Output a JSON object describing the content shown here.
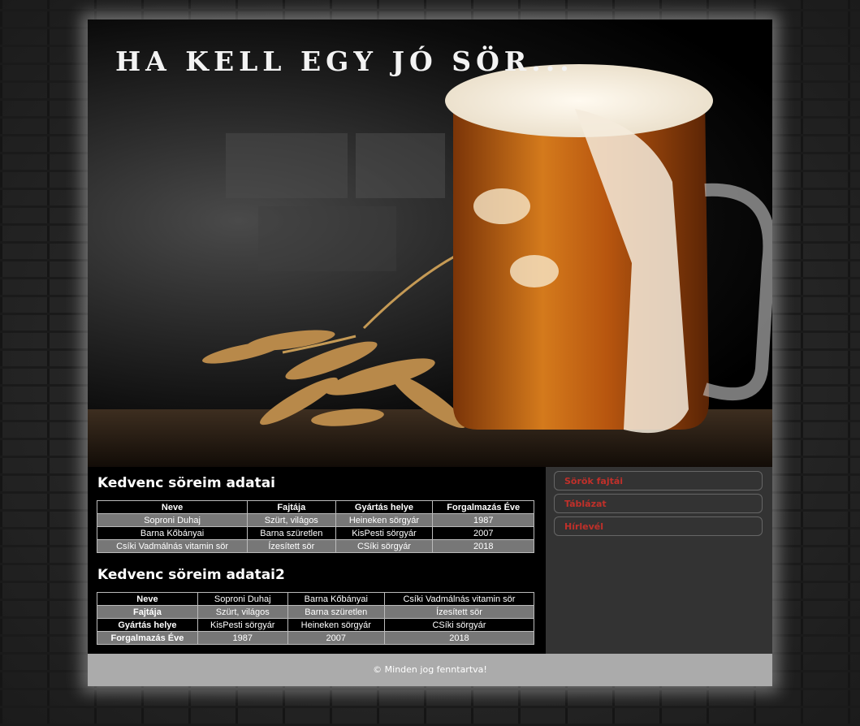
{
  "header": {
    "title": "HA KELL EGY JÓ SÖR..."
  },
  "section1": {
    "title": "Kedvenc söreim adatai",
    "columns": [
      "Neve",
      "Fajtája",
      "Gyártás helye",
      "Forgalmazás Éve"
    ],
    "rows": [
      [
        "Soproni Duhaj",
        "Szürt, világos",
        "Heineken sörgyár",
        "1987"
      ],
      [
        "Barna Kőbányai",
        "Barna szüretlen",
        "KisPesti sörgyár",
        "2007"
      ],
      [
        "Csíki Vadmálnás vitamin sör",
        "Ízesített sör",
        "CSíki sörgyár",
        "2018"
      ]
    ]
  },
  "section2": {
    "title": "Kedvenc söreim adatai2",
    "rows": [
      [
        "Neve",
        "Soproni Duhaj",
        "Barna Kőbányai",
        "Csíki Vadmálnás vitamin sör"
      ],
      [
        "Fajtája",
        "Szürt, világos",
        "Barna szüretlen",
        "Ízesített sör"
      ],
      [
        "Gyártás helye",
        "KisPesti sörgyár",
        "Heineken sörgyár",
        "CSíki sörgyár"
      ],
      [
        "Forgalmazás Éve",
        "1987",
        "2007",
        "2018"
      ]
    ]
  },
  "sidebar": {
    "items": [
      {
        "label": "Sörök fajtái"
      },
      {
        "label": "Táblázat"
      },
      {
        "label": "Hírlevél"
      }
    ]
  },
  "footer": {
    "text": "© Minden jog fenntartva!"
  },
  "colors": {
    "menu_text": "#c0302a",
    "footer_bg": "#ababab",
    "sidebar_bg": "#333333"
  }
}
